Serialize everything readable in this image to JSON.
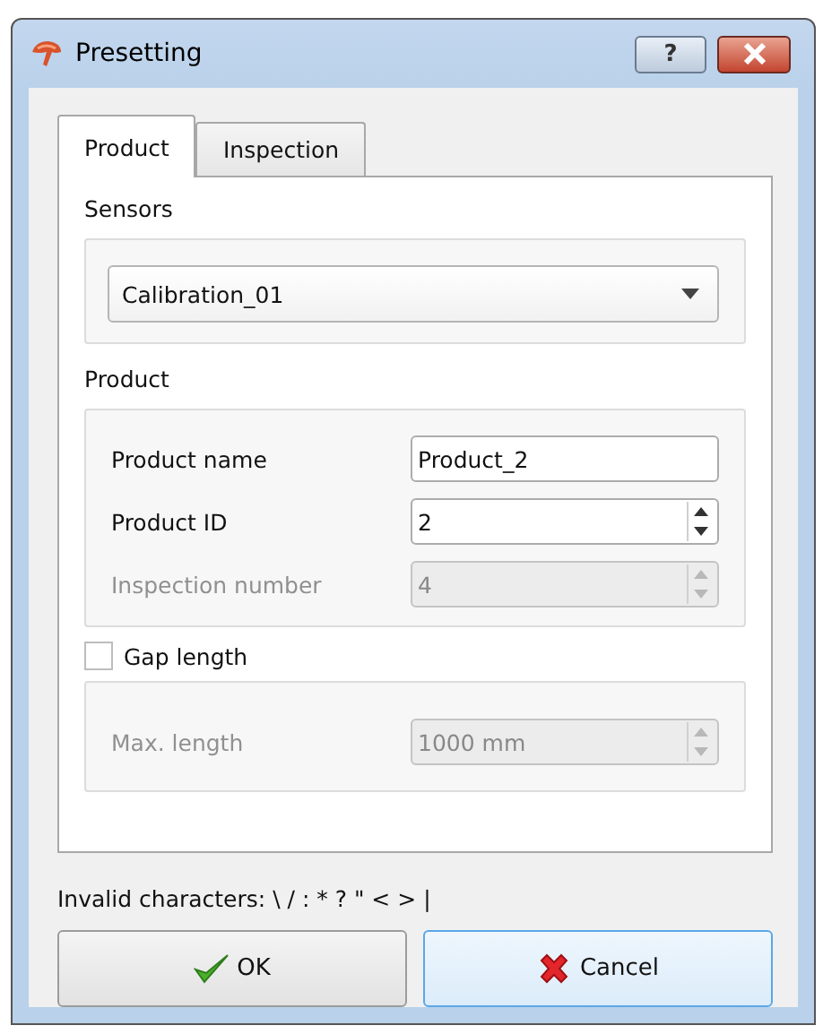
{
  "window": {
    "title": "Presetting",
    "help_button": "?"
  },
  "tabs": [
    {
      "label": "Product",
      "selected": true
    },
    {
      "label": "Inspection",
      "selected": false
    }
  ],
  "sensors": {
    "label": "Sensors",
    "combo_value": "Calibration_01"
  },
  "product": {
    "label": "Product",
    "fields": [
      {
        "kind": "text",
        "label": "Product name",
        "value": "Product_2",
        "disabled": false
      },
      {
        "kind": "spin",
        "label": "Product ID",
        "value": "2",
        "disabled": false
      },
      {
        "kind": "spin",
        "label": "Inspection number",
        "value": "4",
        "disabled": true
      }
    ]
  },
  "gap": {
    "label": "Gap length",
    "checked": false,
    "fields": [
      {
        "kind": "spin",
        "label": "Max. length",
        "value": "1000 mm",
        "disabled": true
      }
    ]
  },
  "note": "Invalid characters: \\ / : * ? \" < > |",
  "buttons": [
    {
      "kind": "ok",
      "label": "OK",
      "focused": false
    },
    {
      "kind": "cancel",
      "label": "Cancel",
      "focused": true
    }
  ]
}
